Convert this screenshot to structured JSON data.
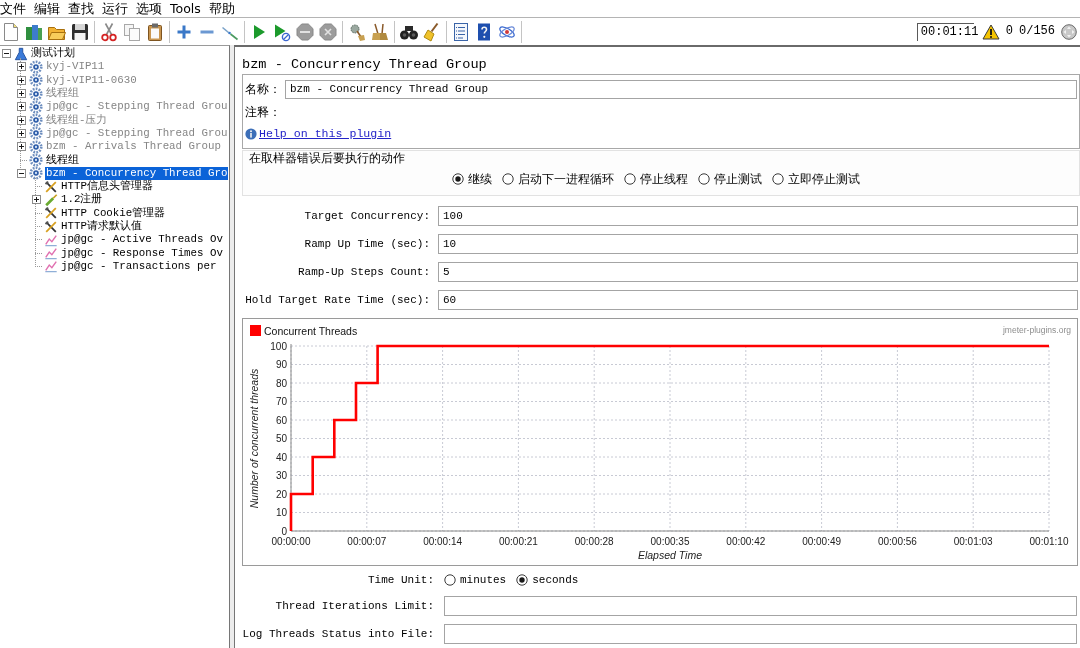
{
  "menu": [
    "文件",
    "编辑",
    "查找",
    "运行",
    "选项",
    "Tools",
    "帮助"
  ],
  "toolbar": [
    [
      {
        "kind": "new",
        "disabled": false
      },
      {
        "kind": "templates",
        "disabled": false
      },
      {
        "kind": "open",
        "disabled": false
      },
      {
        "kind": "save",
        "disabled": false
      }
    ],
    [
      {
        "kind": "cut",
        "disabled": false
      },
      {
        "kind": "copy",
        "disabled": false
      },
      {
        "kind": "paste",
        "disabled": false
      }
    ],
    [
      {
        "kind": "expand",
        "disabled": false
      },
      {
        "kind": "collapse",
        "disabled": false
      },
      {
        "kind": "toggle",
        "disabled": false
      }
    ],
    [
      {
        "kind": "start",
        "disabled": false
      },
      {
        "kind": "start_no_pauses",
        "disabled": false
      },
      {
        "kind": "stop",
        "disabled": true
      },
      {
        "kind": "shutdown",
        "disabled": true
      }
    ],
    [
      {
        "kind": "clear",
        "disabled": false
      },
      {
        "kind": "clear_all",
        "disabled": false
      }
    ],
    [
      {
        "kind": "search",
        "disabled": false
      },
      {
        "kind": "reset_search",
        "disabled": false
      }
    ],
    [
      {
        "kind": "function_helper",
        "disabled": false
      },
      {
        "kind": "help",
        "disabled": false
      },
      {
        "kind": "remote",
        "disabled": false
      }
    ]
  ],
  "status": {
    "elapsed": "00:01:11",
    "errors": "0",
    "threads": "0/156"
  },
  "tree": {
    "items": [
      {
        "label": "测试计划",
        "kind": "plan",
        "leaf": false,
        "expanded": true,
        "disabled": false,
        "selected": false,
        "children": [
          {
            "label": "kyj-VIP11",
            "kind": "thread_group",
            "leaf": false,
            "expanded": false,
            "disabled": true,
            "selected": false
          },
          {
            "label": "kyj-VIP11-0630",
            "kind": "thread_group",
            "leaf": false,
            "expanded": false,
            "disabled": true,
            "selected": false
          },
          {
            "label": "线程组",
            "kind": "thread_group",
            "leaf": false,
            "expanded": false,
            "disabled": true,
            "selected": false
          },
          {
            "label": "jp@gc - Stepping Thread Grou",
            "kind": "thread_group",
            "leaf": false,
            "expanded": false,
            "disabled": true,
            "selected": false
          },
          {
            "label": "线程组-压力",
            "kind": "thread_group",
            "leaf": false,
            "expanded": false,
            "disabled": true,
            "selected": false
          },
          {
            "label": "jp@gc - Stepping Thread Grou",
            "kind": "thread_group",
            "leaf": false,
            "expanded": false,
            "disabled": true,
            "selected": false
          },
          {
            "label": "bzm - Arrivals Thread Group",
            "kind": "thread_group",
            "leaf": false,
            "expanded": false,
            "disabled": true,
            "selected": false
          },
          {
            "label": "线程组",
            "kind": "thread_group",
            "leaf": true,
            "expanded": false,
            "disabled": false,
            "selected": false
          },
          {
            "label": "bzm - Concurrency Thread Gro",
            "kind": "thread_group",
            "leaf": false,
            "expanded": true,
            "disabled": false,
            "selected": true,
            "children": [
              {
                "label": "HTTP信息头管理器",
                "kind": "config",
                "leaf": true,
                "expanded": false,
                "disabled": false,
                "selected": false
              },
              {
                "label": "1.2注册",
                "kind": "controller",
                "leaf": false,
                "expanded": false,
                "disabled": false,
                "selected": false
              },
              {
                "label": "HTTP Cookie管理器",
                "kind": "config",
                "leaf": true,
                "expanded": false,
                "disabled": false,
                "selected": false
              },
              {
                "label": "HTTP请求默认值",
                "kind": "config",
                "leaf": true,
                "expanded": false,
                "disabled": false,
                "selected": false
              },
              {
                "label": "jp@gc - Active Threads Ov",
                "kind": "listener",
                "leaf": true,
                "expanded": false,
                "disabled": false,
                "selected": false
              },
              {
                "label": "jp@gc - Response Times Ov",
                "kind": "listener",
                "leaf": true,
                "expanded": false,
                "disabled": false,
                "selected": false
              },
              {
                "label": "jp@gc - Transactions per",
                "kind": "listener",
                "leaf": true,
                "expanded": false,
                "disabled": false,
                "selected": false
              }
            ]
          }
        ]
      }
    ]
  },
  "editor": {
    "title": "bzm - Concurrency Thread Group",
    "name_label": "名称：",
    "name_value": "bzm - Concurrency Thread Group",
    "comment_label": "注释：",
    "help_link": "Help on this plugin",
    "error_action": {
      "title": "在取样器错误后要执行的动作",
      "options": [
        {
          "label": "继续",
          "selected": true
        },
        {
          "label": "启动下一进程循环",
          "selected": false
        },
        {
          "label": "停止线程",
          "selected": false
        },
        {
          "label": "停止测试",
          "selected": false
        },
        {
          "label": "立即停止测试",
          "selected": false
        }
      ]
    },
    "fields": [
      {
        "label": "Target Concurrency:",
        "value": "100"
      },
      {
        "label": "Ramp Up Time (sec):",
        "value": "10"
      },
      {
        "label": "Ramp-Up Steps Count:",
        "value": "5"
      },
      {
        "label": "Hold Target Rate Time (sec):",
        "value": "60"
      }
    ],
    "chart": {
      "brand": "jmeter-plugins.org",
      "chart_data": {
        "type": "line",
        "grid": true,
        "xlabel": "Elapsed Time",
        "ylabel": "Number of concurrent threads",
        "x": [
          0,
          0,
          2,
          2,
          4,
          4,
          6,
          6,
          8,
          8,
          70
        ],
        "series": [
          {
            "name": "Concurrent Threads",
            "color": "#ff0000",
            "values": [
              0,
              20,
              20,
              40,
              40,
              60,
              60,
              80,
              80,
              100,
              100
            ]
          }
        ],
        "xlim": [
          0,
          70
        ],
        "ylim": [
          0,
          100
        ],
        "xticks": [
          {
            "value": 0,
            "label": "00:00:00"
          },
          {
            "value": 7,
            "label": "00:00:07"
          },
          {
            "value": 14,
            "label": "00:00:14"
          },
          {
            "value": 21,
            "label": "00:00:21"
          },
          {
            "value": 28,
            "label": "00:00:28"
          },
          {
            "value": 35,
            "label": "00:00:35"
          },
          {
            "value": 42,
            "label": "00:00:42"
          },
          {
            "value": 49,
            "label": "00:00:49"
          },
          {
            "value": 56,
            "label": "00:00:56"
          },
          {
            "value": 63,
            "label": "00:01:03"
          },
          {
            "value": 70,
            "label": "00:01:10"
          }
        ],
        "yticks": [
          0,
          10,
          20,
          30,
          40,
          50,
          60,
          70,
          80,
          90,
          100
        ]
      }
    },
    "time_unit": {
      "label": "Time Unit:",
      "options": [
        {
          "label": "minutes",
          "selected": false
        },
        {
          "label": "seconds",
          "selected": true
        }
      ]
    },
    "bottom_fields": [
      {
        "label": "Thread Iterations Limit:"
      },
      {
        "label": "Log Threads Status into File:"
      }
    ]
  }
}
